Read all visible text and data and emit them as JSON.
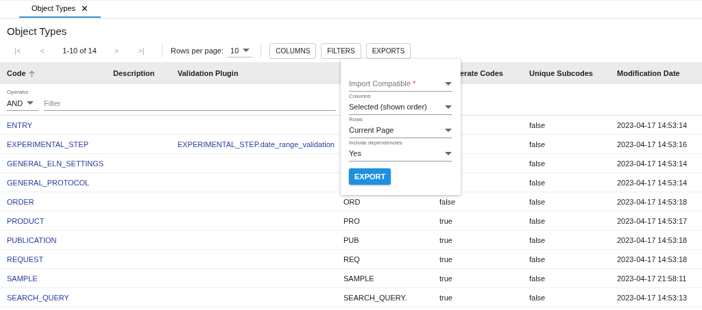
{
  "tabs": [
    {
      "label": "Object Types",
      "close": "✕",
      "selected": true
    }
  ],
  "title": "Object Types",
  "pager": {
    "first": "|<",
    "prev": "<",
    "range": "1-10 of 14",
    "next": ">",
    "last": ">|",
    "rows_label": "Rows per page:",
    "rows_value": "10"
  },
  "buttons": [
    "COLUMNS",
    "FILTERS",
    "EXPORTS"
  ],
  "table": {
    "columns": [
      {
        "label": "Code",
        "sorted": true
      },
      {
        "label": "Description"
      },
      {
        "label": "Validation Plugin"
      },
      {},
      {
        "label": "erate Codes"
      },
      {
        "label": "Unique Subcodes"
      },
      {
        "label": "Modification Date"
      }
    ],
    "filter": {
      "operator_label": "Operator",
      "operator": "AND",
      "placeholder": "Filter"
    },
    "rows": [
      [
        "ENTRY",
        "",
        "",
        "",
        "",
        "false",
        "2023-04-17 14:53:14"
      ],
      [
        "EXPERIMENTAL_STEP",
        "",
        "EXPERIMENTAL_STEP.date_range_validation",
        "",
        "",
        "false",
        "2023-04-17 14:53:16"
      ],
      [
        "GENERAL_ELN_SETTINGS",
        "",
        "",
        "",
        "",
        "false",
        "2023-04-17 14:53:14"
      ],
      [
        "GENERAL_PROTOCOL",
        "",
        "",
        "",
        "",
        "false",
        "2023-04-17 14:53:14"
      ],
      [
        "ORDER",
        "",
        "",
        "ORD",
        "false",
        "false",
        "2023-04-17 14:53:18"
      ],
      [
        "PRODUCT",
        "",
        "",
        "PRO",
        "true",
        "false",
        "2023-04-17 14:53:17"
      ],
      [
        "PUBLICATION",
        "",
        "",
        "PUB",
        "true",
        "false",
        "2023-04-17 14:53:18"
      ],
      [
        "REQUEST",
        "",
        "",
        "REQ",
        "true",
        "false",
        "2023-04-17 14:53:18"
      ],
      [
        "SAMPLE",
        "",
        "",
        "SAMPLE",
        "true",
        "false",
        "2023-04-17 21:58:11"
      ],
      [
        "SEARCH_QUERY",
        "",
        "",
        "SEARCH_QUERY.",
        "true",
        "false",
        "2023-04-17 14:53:13"
      ]
    ]
  },
  "export_popup": {
    "fields": [
      {
        "placeholder": "Import Compatible",
        "required_mark": "*"
      },
      {
        "label": "Columns",
        "value": "Selected (shown order)"
      },
      {
        "label": "Rows",
        "value": "Current Page"
      },
      {
        "label": "Include dependencies",
        "value": "Yes"
      }
    ],
    "button": "EXPORT"
  }
}
